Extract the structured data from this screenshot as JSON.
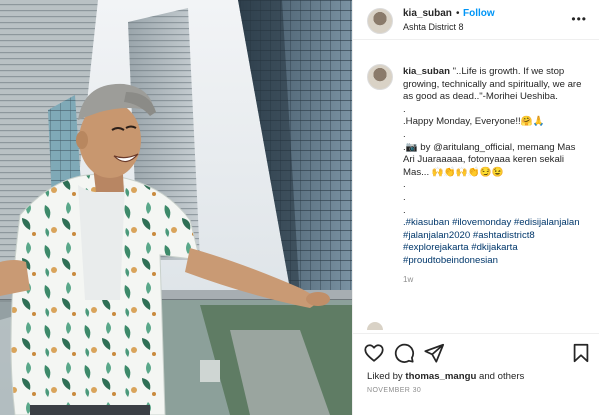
{
  "header": {
    "username": "kia_suban",
    "dot": "•",
    "follow_label": "Follow",
    "location": "Ashta District 8",
    "more_icon": "more-horizontal-icon"
  },
  "caption": {
    "username": "kia_suban",
    "lines": [
      "\"..Life is growth. If we stop growing, technically and spiritually, we are as good as dead..\"-Morihei Ueshiba.",
      ".",
      ".Happy Monday, Everyone!!🤗🙏",
      ".",
      ".📷 by @aritulang_official, memang Mas Ari Juaraaaaa, fotonyaaa keren sekali Mas... 🙌👏🙌👏😏😉",
      ".",
      ".",
      ".",
      ".#kiasuban #ilovemonday #edisijalanjalan #jalanjalan2020 #ashtadistrict8 #explorejakarta #dkijakarta #proudtobeindonesian"
    ],
    "time_ago": "1w"
  },
  "actions": {
    "like_icon": "heart-icon",
    "comment_icon": "comment-icon",
    "share_icon": "send-icon",
    "save_icon": "bookmark-icon"
  },
  "likes": {
    "prefix": "Liked by ",
    "user": "thomas_mangu",
    "suffix": " and others"
  },
  "date": "NOVEMBER 30",
  "colors": {
    "follow_blue": "#0095f6",
    "hashtag": "#00376b",
    "muted": "#8e8e8e"
  }
}
